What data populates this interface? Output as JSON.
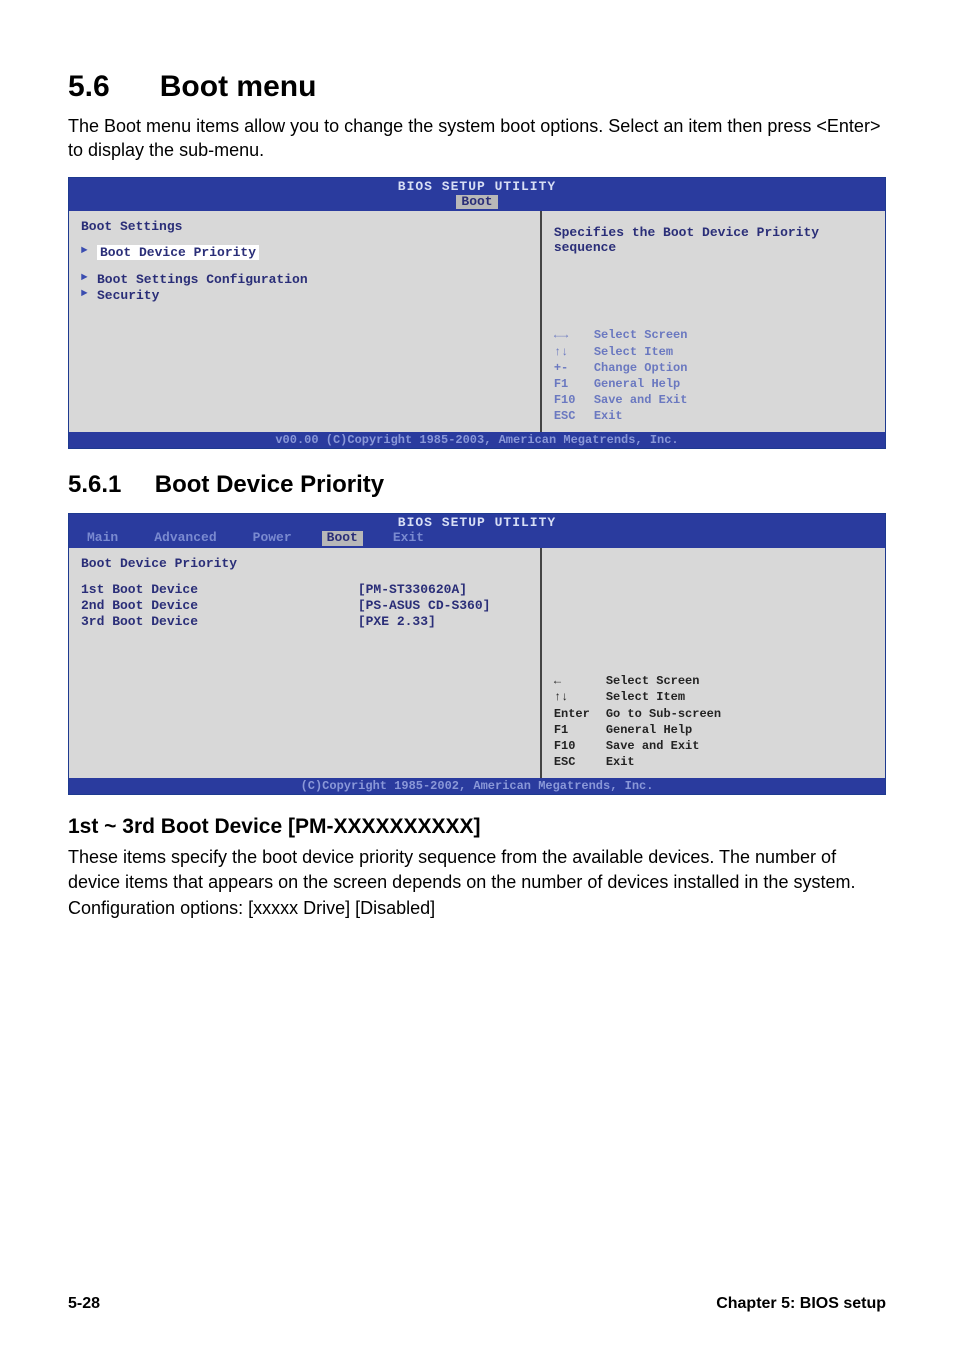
{
  "section": {
    "number": "5.6",
    "title": "Boot menu",
    "intro": "The Boot menu items allow you to change the system boot options. Select an item then press <Enter> to display the sub-menu."
  },
  "bios1": {
    "title": "BIOS SETUP UTILITY",
    "tab_active": "Boot",
    "left_title": "Boot Settings",
    "items": [
      "Boot Device Priority",
      "Boot Settings Configuration",
      "Security"
    ],
    "help": "Specifies the Boot Device Priority sequence",
    "nav": [
      {
        "key": "←→",
        "label": "Select Screen"
      },
      {
        "key": "↑↓",
        "label": "Select Item"
      },
      {
        "key": "+-",
        "label": "Change Option"
      },
      {
        "key": "F1",
        "label": "General Help"
      },
      {
        "key": "F10",
        "label": "Save and Exit"
      },
      {
        "key": "ESC",
        "label": "Exit"
      }
    ],
    "footer": "v00.00 (C)Copyright 1985-2003, American Megatrends, Inc."
  },
  "subsection": {
    "number": "5.6.1",
    "title": "Boot Device Priority"
  },
  "bios2": {
    "title": "BIOS SETUP UTILITY",
    "tabs": [
      "Main",
      "Advanced",
      "Power",
      "Boot",
      "Exit"
    ],
    "tab_active": "Boot",
    "left_title": "Boot Device Priority",
    "rows": [
      {
        "label": "1st Boot Device",
        "value": "[PM-ST330620A]"
      },
      {
        "label": "2nd Boot Device",
        "value": "[PS-ASUS CD-S360]"
      },
      {
        "label": "3rd Boot Device",
        "value": "[PXE 2.33]"
      }
    ],
    "nav": [
      {
        "key": "←",
        "label": "Select Screen"
      },
      {
        "key": "↑↓",
        "label": "Select Item"
      },
      {
        "key": "Enter",
        "label": "Go to Sub-screen"
      },
      {
        "key": "F1",
        "label": "General Help"
      },
      {
        "key": "F10",
        "label": "Save and Exit"
      },
      {
        "key": "ESC",
        "label": "Exit"
      }
    ],
    "footer": "(C)Copyright 1985-2002, American Megatrends, Inc."
  },
  "item_section": {
    "heading": "1st ~ 3rd Boot Device [PM-XXXXXXXXXX]",
    "para": "These items specify the boot device priority sequence from the available devices. The number of device items that appears on the screen depends on the number of devices installed in the system.",
    "config": "Configuration options: [xxxxx Drive] [Disabled]"
  },
  "footer": {
    "page": "5-28",
    "chapter": "Chapter 5: BIOS setup"
  }
}
